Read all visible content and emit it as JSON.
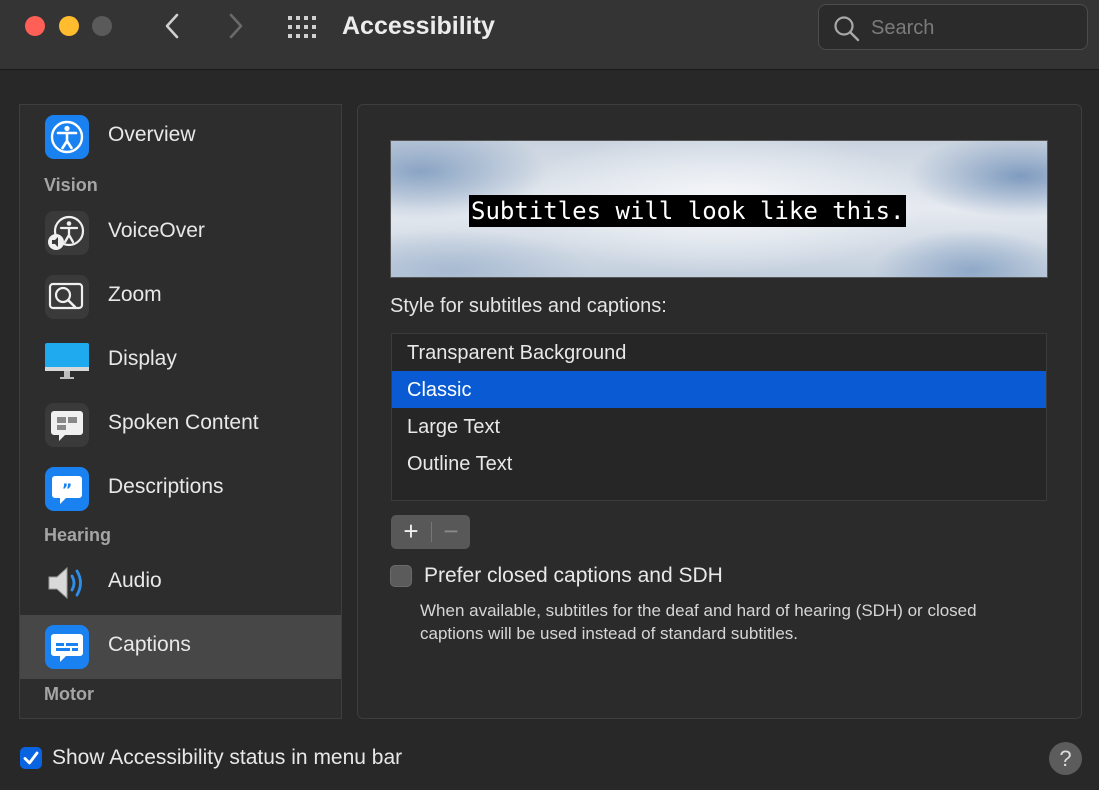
{
  "window": {
    "title": "Accessibility",
    "search_placeholder": "Search"
  },
  "sidebar": {
    "items": [
      {
        "label": "Overview",
        "icon": "accessibility-person-icon"
      },
      {
        "header": "Vision"
      },
      {
        "label": "VoiceOver",
        "icon": "voiceover-icon"
      },
      {
        "label": "Zoom",
        "icon": "zoom-icon"
      },
      {
        "label": "Display",
        "icon": "display-icon"
      },
      {
        "label": "Spoken Content",
        "icon": "spoken-content-icon"
      },
      {
        "label": "Descriptions",
        "icon": "descriptions-icon"
      },
      {
        "header": "Hearing"
      },
      {
        "label": "Audio",
        "icon": "speaker-icon"
      },
      {
        "label": "Captions",
        "icon": "captions-icon",
        "selected": true
      },
      {
        "header": "Motor"
      }
    ]
  },
  "captions": {
    "preview_text": "Subtitles will look like this.",
    "style_label": "Style for subtitles and captions:",
    "styles": [
      "Transparent Background",
      "Classic",
      "Large Text",
      "Outline Text"
    ],
    "selected_style": "Classic",
    "add_label": "+",
    "remove_label": "−",
    "prefer_sdh_label": "Prefer closed captions and SDH",
    "prefer_sdh_checked": false,
    "prefer_sdh_description": "When available, subtitles for the deaf and hard of hearing (SDH) or closed captions will be used instead of standard subtitles."
  },
  "footer": {
    "show_status_label": "Show Accessibility status in menu bar",
    "show_status_checked": true,
    "help_label": "?"
  },
  "colors": {
    "accent": "#0a5bd3",
    "window_bg": "#282828"
  }
}
